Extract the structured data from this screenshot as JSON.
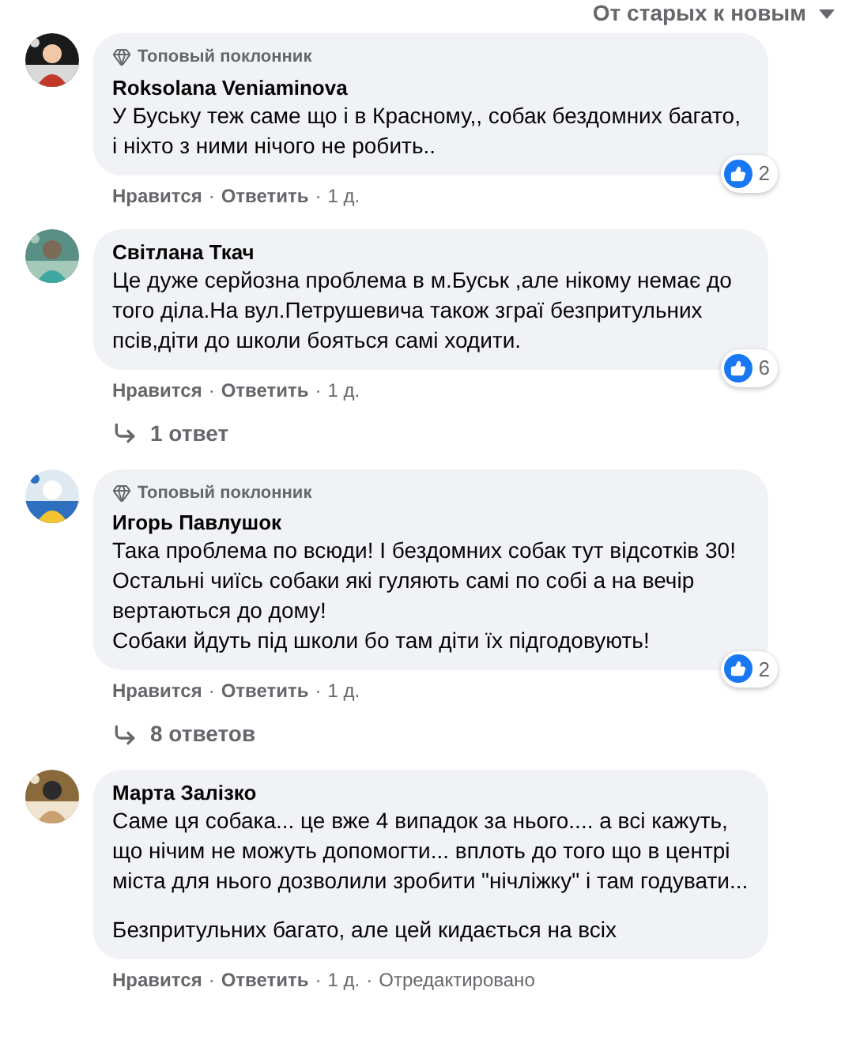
{
  "sort": {
    "label": "От старых к новым"
  },
  "comments": [
    {
      "badge": "Топовый поклонник",
      "author": "Roksolana Veniaminova",
      "paragraphs": [
        "У Буську теж саме що і в Красному,, собак бездомних багато, і ніхто з ними нічого не робить.."
      ],
      "reactions": "2",
      "like": "Нравится",
      "separator": "·",
      "reply": "Ответить",
      "time": "1 д."
    },
    {
      "author": "Світлана Ткач",
      "paragraphs": [
        "Це дуже серйозна проблема в м.Буськ ,але нікому немає до того діла.На вул.Петрушевича також зграї безпритульних псів,діти до школи бояться самі ходити."
      ],
      "reactions": "6",
      "like": "Нравится",
      "separator": "·",
      "reply": "Ответить",
      "time": "1 д.",
      "replies": "1 ответ"
    },
    {
      "badge": "Топовый поклонник",
      "author": "Игорь Павлушок",
      "paragraphs": [
        "Така проблема по всюди! І бездомних собак тут відсотків 30! Остальні чиїсь собаки які гуляють самі по собі а на вечір вертаються до дому!\nСобаки йдуть під школи бо там діти їх підгодовують!"
      ],
      "reactions": "2",
      "like": "Нравится",
      "separator": "·",
      "reply": "Ответить",
      "time": "1 д.",
      "replies": "8 ответов"
    },
    {
      "author": "Марта Залізко",
      "paragraphs": [
        "Саме ця собака... це вже 4 випадок за нього.... а всі кажуть, що нічим не можуть допомогти... вплоть до того що в центрі міста для нього дозволили зробити \"нічліжку\" і там годувати...",
        "Безпритульних багато, але цей кидається на всіх"
      ],
      "like": "Нравится",
      "separator": "·",
      "reply": "Ответить",
      "time": "1 д.",
      "edited": "Отредактировано"
    }
  ]
}
